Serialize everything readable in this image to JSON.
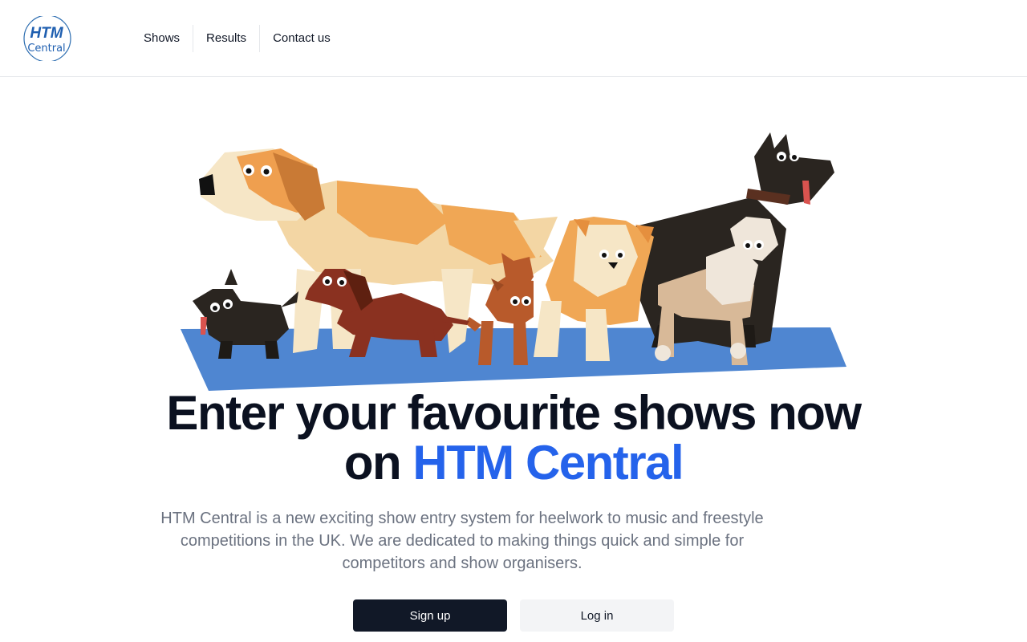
{
  "brand": {
    "logo_line1": "HTM",
    "logo_line2": "Central",
    "accent_color": "#2563eb"
  },
  "nav": {
    "items": [
      {
        "label": "Shows"
      },
      {
        "label": "Results"
      },
      {
        "label": "Contact us"
      }
    ]
  },
  "hero": {
    "illustration": "dogs-illustration",
    "headline_part1": "Enter your favourite shows now",
    "headline_part2": "on",
    "headline_accent": "HTM Central",
    "description": "HTM Central is a new exciting show entry system for heelwork to music and freestyle competitions in the UK. We are dedicated to making things quick and simple for competitors and show organisers.",
    "primary_button": "Sign up",
    "secondary_button": "Log in"
  }
}
